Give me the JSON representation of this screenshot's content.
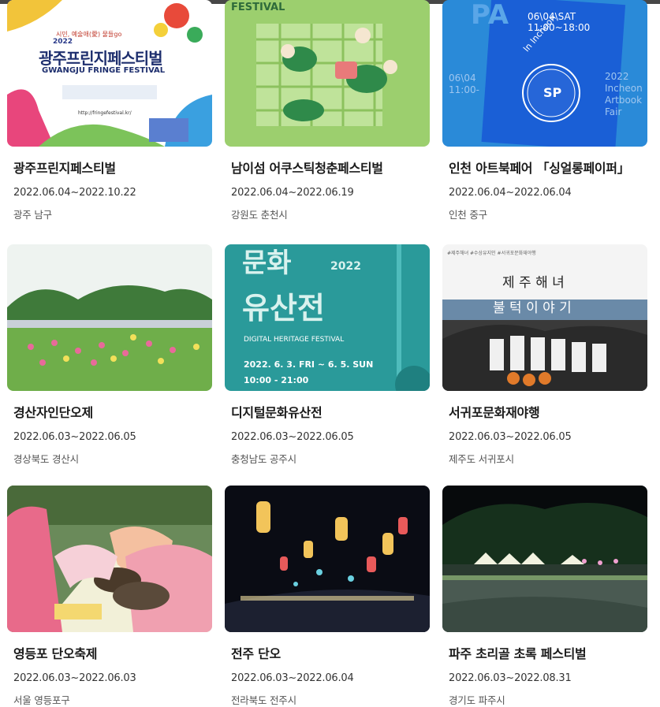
{
  "festivals": [
    {
      "title": "광주프린지페스티벌",
      "dates": "2022.06.04~2022.10.22",
      "region": "광주 남구",
      "poster": {
        "headline": "광주프린지페스티벌",
        "sub": "GWANGJU FRINGE FESTIVAL",
        "slogan": "시민, 예술애(愛) 물들go",
        "year": "2022",
        "url": "http://fringefestival.kr/"
      }
    },
    {
      "title": "남이섬 어쿠스틱청춘페스티벌",
      "dates": "2022.06.04~2022.06.19",
      "region": "강원도 춘천시",
      "poster": {
        "headline": "FESTIVAL"
      }
    },
    {
      "title": "인천 아트북페어 「싱얼롱페이퍼」",
      "dates": "2022.06.04~2022.06.04",
      "region": "인천 중구",
      "poster": {
        "date_line": "06\\04\\SAT",
        "time_line": "11:00~18:00",
        "side": "In Incheon",
        "right": "2022 Incheon Artbook Fair",
        "badge": "SP",
        "left": "06\\04 11:00-"
      }
    },
    {
      "title": "경산자인단오제",
      "dates": "2022.06.03~2022.06.05",
      "region": "경상북도 경산시",
      "poster": {}
    },
    {
      "title": "디지털문화유산전",
      "dates": "2022.06.03~2022.06.05",
      "region": "충청남도 공주시",
      "poster": {
        "line1": "문화",
        "line2": "유산전",
        "year": "2022",
        "sub": "DIGITAL HERITAGE FESTIVAL",
        "date": "2022. 6. 3. FRI ~ 6. 5. SUN",
        "time": "10:00 - 21:00"
      }
    },
    {
      "title": "서귀포문화재야행",
      "dates": "2022.06.03~2022.06.05",
      "region": "제주도 서귀포시",
      "poster": {
        "line1": "제 주 해 녀",
        "line2": "불 턱 이 야 기",
        "small": "#제주해녀 #수상유지인 #서귀포문화재야행"
      }
    },
    {
      "title": "영등포 단오축제",
      "dates": "2022.06.03~2022.06.03",
      "region": "서울 영등포구",
      "poster": {}
    },
    {
      "title": "전주 단오",
      "dates": "2022.06.03~2022.06.04",
      "region": "전라북도 전주시",
      "poster": {}
    },
    {
      "title": "파주 초리골 초록 페스티벌",
      "dates": "2022.06.03~2022.08.31",
      "region": "경기도 파주시",
      "poster": {}
    }
  ],
  "colors": {
    "title": "#1a1a1a",
    "meta": "#444444"
  }
}
